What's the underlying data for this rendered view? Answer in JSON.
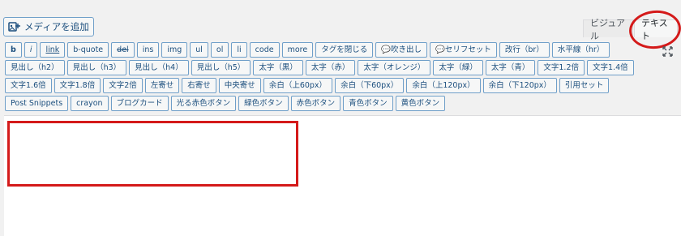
{
  "media_button": {
    "label": "メディアを追加",
    "icon": "media-add-icon"
  },
  "tabs": {
    "visual": "ビジュアル",
    "text": "テキスト"
  },
  "fullscreen": {
    "icon": "fullscreen-expand-icon"
  },
  "annotation_color": "#d41a1a",
  "quicktags": [
    {
      "label": "b",
      "style": "bold"
    },
    {
      "label": "i",
      "style": "ital"
    },
    {
      "label": "link",
      "style": "link"
    },
    {
      "label": "b-quote",
      "style": ""
    },
    {
      "label": "del",
      "style": "del"
    },
    {
      "label": "ins",
      "style": ""
    },
    {
      "label": "img",
      "style": ""
    },
    {
      "label": "ul",
      "style": ""
    },
    {
      "label": "ol",
      "style": ""
    },
    {
      "label": "li",
      "style": ""
    },
    {
      "label": "code",
      "style": ""
    },
    {
      "label": "more",
      "style": ""
    },
    {
      "label": "タグを閉じる",
      "style": ""
    },
    {
      "label": "💬吹き出し",
      "style": ""
    },
    {
      "label": "💬セリフセット",
      "style": ""
    },
    {
      "label": "改行（br）",
      "style": ""
    },
    {
      "label": "水平線（hr）",
      "style": ""
    },
    {
      "label": "見出し（h2）",
      "style": ""
    },
    {
      "label": "見出し（h3）",
      "style": ""
    },
    {
      "label": "見出し（h4）",
      "style": ""
    },
    {
      "label": "見出し（h5）",
      "style": ""
    },
    {
      "label": "太字（黒）",
      "style": ""
    },
    {
      "label": "太字（赤）",
      "style": ""
    },
    {
      "label": "太字（オレンジ）",
      "style": ""
    },
    {
      "label": "太字（緑）",
      "style": ""
    },
    {
      "label": "太字（青）",
      "style": ""
    },
    {
      "label": "文字1.2倍",
      "style": ""
    },
    {
      "label": "文字1.4倍",
      "style": ""
    },
    {
      "label": "文字1.6倍",
      "style": ""
    },
    {
      "label": "文字1.8倍",
      "style": ""
    },
    {
      "label": "文字2倍",
      "style": ""
    },
    {
      "label": "左寄せ",
      "style": ""
    },
    {
      "label": "右寄せ",
      "style": ""
    },
    {
      "label": "中央寄せ",
      "style": ""
    },
    {
      "label": "余白（上60px）",
      "style": ""
    },
    {
      "label": "余白（下60px）",
      "style": ""
    },
    {
      "label": "余白（上120px）",
      "style": ""
    },
    {
      "label": "余白（下120px）",
      "style": ""
    },
    {
      "label": "引用セット",
      "style": ""
    },
    {
      "label": "Post Snippets",
      "style": ""
    },
    {
      "label": "crayon",
      "style": ""
    },
    {
      "label": "ブログカード",
      "style": ""
    },
    {
      "label": "光る赤色ボタン",
      "style": ""
    },
    {
      "label": "緑色ボタン",
      "style": ""
    },
    {
      "label": "赤色ボタン",
      "style": ""
    },
    {
      "label": "青色ボタン",
      "style": ""
    },
    {
      "label": "黄色ボタン",
      "style": ""
    }
  ],
  "editor": {
    "content": ""
  }
}
